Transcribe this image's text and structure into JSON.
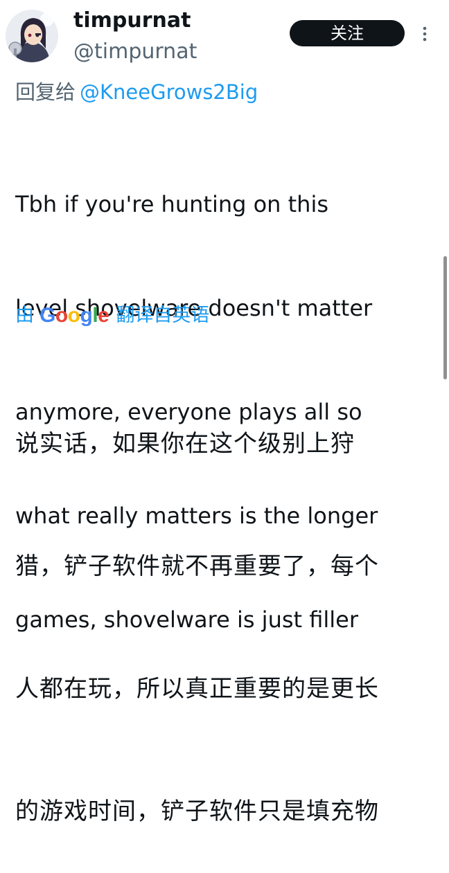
{
  "author": {
    "display_name": "timpurnat",
    "handle": "@timpurnat"
  },
  "actions": {
    "follow_label": "关注",
    "more_icon": "more-vertical-icon"
  },
  "reply_to": {
    "prefix": "回复给",
    "mention": "@KneeGrows2Big"
  },
  "tweet": {
    "lines": [
      "Tbh if you're hunting on this",
      "level shovelware doesn't matter",
      "anymore, everyone plays all so",
      "what really matters is the longer",
      "games, shovelware is just filler"
    ]
  },
  "translation": {
    "by": "由",
    "google_letters": [
      {
        "char": "G",
        "color": "#4285F4"
      },
      {
        "char": "o",
        "color": "#EA4335"
      },
      {
        "char": "o",
        "color": "#FBBC05"
      },
      {
        "char": "g",
        "color": "#4285F4"
      },
      {
        "char": "l",
        "color": "#34A853"
      },
      {
        "char": "e",
        "color": "#EA4335"
      }
    ],
    "action_label": "翻译自英语",
    "lines": [
      "说实话，如果你在这个级别上狩",
      "猎，铲子软件就不再重要了，每个",
      "人都在玩，所以真正重要的是更长",
      "的游戏时间，铲子软件只是填充物"
    ]
  },
  "colors": {
    "text": "#0f1419",
    "secondary": "#536471",
    "link": "#1d9bf0",
    "button_bg": "#0f1419"
  }
}
